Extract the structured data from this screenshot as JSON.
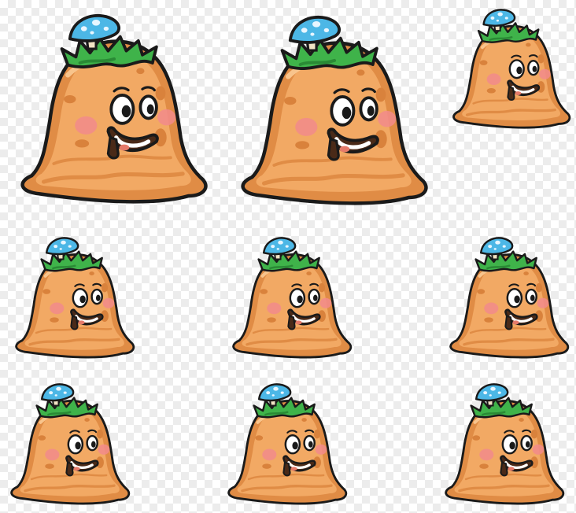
{
  "canvas": {
    "background": "transparent-checkerboard",
    "checker_colors": [
      "#ffffff",
      "#ececec"
    ]
  },
  "sprite_sheet": {
    "character": "orange-slime-monster-with-blue-mushroom",
    "frame_count": 9,
    "frames": [
      {
        "id": "frame-1",
        "pose": "large-happy"
      },
      {
        "id": "frame-2",
        "pose": "large-happy"
      },
      {
        "id": "frame-3",
        "pose": "small-happy"
      },
      {
        "id": "frame-4",
        "pose": "small-happy"
      },
      {
        "id": "frame-5",
        "pose": "small-happy"
      },
      {
        "id": "frame-6",
        "pose": "small-happy"
      },
      {
        "id": "frame-7",
        "pose": "small-happy"
      },
      {
        "id": "frame-8",
        "pose": "small-happy"
      },
      {
        "id": "frame-9",
        "pose": "small-happy"
      }
    ]
  },
  "palette": {
    "body": "#f2a964",
    "body_shadow": "#e08c45",
    "body_light": "#f8c48c",
    "spots": "#d9823c",
    "outline": "#1a1a1a",
    "grass": "#3fb34a",
    "grass_dark": "#2a8a35",
    "mushroom_cap": "#4cb7e6",
    "mushroom_dots": "#e8f6ff",
    "mushroom_stem": "#f1e3c4",
    "cheek": "#f28b8b",
    "mouth": "#4a2a18",
    "tongue": "#e57a6a",
    "eye_white": "#ffffff"
  }
}
